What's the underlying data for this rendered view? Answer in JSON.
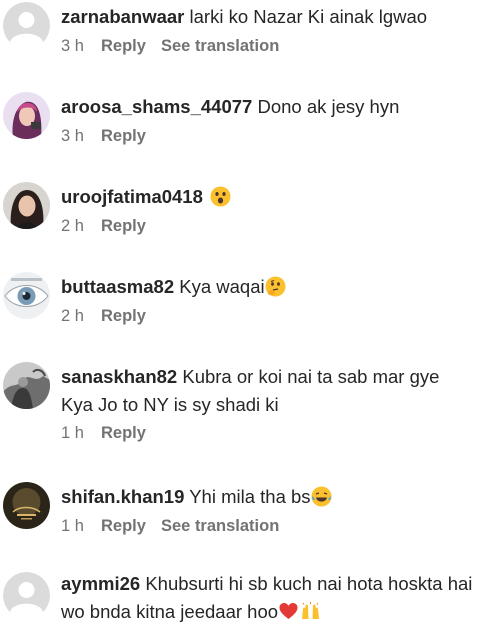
{
  "comments": [
    {
      "username": "zarnabanwaar",
      "text": "larki ko Nazar Ki ainak lgwao",
      "time": "3 h",
      "reply": "Reply",
      "translation": "See translation",
      "avatar": "default-avatar-icon"
    },
    {
      "username": "aroosa_shams_44077",
      "text": "Dono ak jesy hyn",
      "time": "3 h",
      "reply": "Reply",
      "avatar": "profile-photo"
    },
    {
      "username": "uroojfatima0418",
      "text": "",
      "emoji": "astonished-face-emoji",
      "time": "2 h",
      "reply": "Reply",
      "avatar": "profile-photo"
    },
    {
      "username": "buttaasma82",
      "text": "Kya waqai",
      "emoji": "thinking-face-emoji",
      "time": "2 h",
      "reply": "Reply",
      "avatar": "eye-photo"
    },
    {
      "username": "sanaskhan82",
      "text": "Kubra or koi nai ta sab mar gye Kya Jo to NY is sy shadi ki",
      "time": "1 h",
      "reply": "Reply",
      "avatar": "profile-photo"
    },
    {
      "username": "shifan.khan19",
      "text": "Yhi mila tha bs",
      "emoji": "laughing-tears-emoji",
      "time": "1 h",
      "reply": "Reply",
      "translation": "See translation",
      "avatar": "profile-photo"
    },
    {
      "username": "aymmi26",
      "text": "Khubsurti hi sb kuch nai hota hoskta hai wo bnda kitna jeedaar hoo",
      "emoji": "red-heart-emoji raising-hands-emoji",
      "avatar": "default-avatar-icon"
    }
  ],
  "colors": {
    "text": "#262626",
    "meta": "#737373",
    "default_avatar_bg": "#dbdbdb",
    "default_avatar_fg": "#ffffff"
  }
}
